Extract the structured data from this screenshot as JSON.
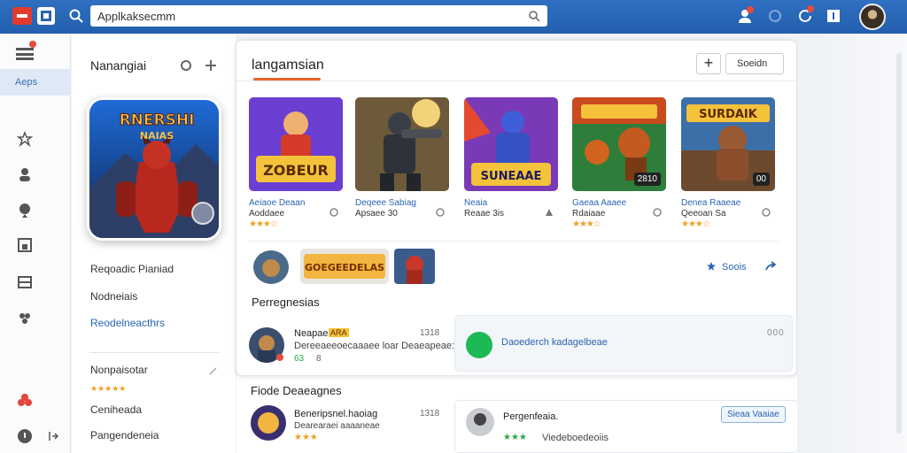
{
  "header": {
    "search_value": "Applkaksecmm",
    "notif_count": "",
    "profile": "avatar"
  },
  "icons": {
    "brand": "brand-logo-icon",
    "grid": "grid-logo-icon",
    "search": "search-icon",
    "user": "user-icon",
    "settings": "settings-icon",
    "refresh": "refresh-icon",
    "info": "info-icon"
  },
  "rail": {
    "active_label": "Aeps"
  },
  "left": {
    "title": "Nanangiai",
    "links": [
      "Reqoadic Pianiad",
      "Nodneiais",
      "Reodelneacthrs"
    ],
    "section_title": "Nonpaisotar",
    "section_stars": "★★★★★",
    "sub_links": [
      "Ceniheada",
      "Pangendeneia"
    ]
  },
  "panel": {
    "title": "langamsian",
    "add_label": "+",
    "sort_label": "Soeidn",
    "apps": [
      {
        "name": "Aeiaoe Deaan",
        "dev": "Aoddaee",
        "stars": "★★★☆",
        "art": "ZOBEUR",
        "tag": ""
      },
      {
        "name": "Deqeee Sabiag",
        "dev": "Apsaee 30",
        "stars": "",
        "art": "",
        "tag": ""
      },
      {
        "name": "Neaia",
        "dev": "Reaae 3is",
        "stars": "",
        "art": "SUNEAAE",
        "tag": ""
      },
      {
        "name": "Gaeaa Aaaee",
        "dev": "Rdaiaae",
        "stars": "★★★☆",
        "art": "",
        "tag": "2810"
      },
      {
        "name": "Denea Raaeae",
        "dev": "Qeeoan Sa",
        "stars": "★★★☆",
        "art": "SURDAIK",
        "tag": "00"
      }
    ],
    "banner_text": "GOEGEEDELAS",
    "share_label": "Soois",
    "section1": "Perregnesias",
    "msg1": {
      "name": "Neapae",
      "tag": "ARA",
      "desc": "Dereeaeeoecaaaee loar Deaeapeae:",
      "meta_left": "63",
      "meta_mid": "8",
      "time": "1318",
      "dots": "000"
    },
    "chat1": "Daoederch kadagelbeae",
    "section2": "Fiode Deaeagnes",
    "msg2": {
      "name": "Beneripsnel.haoiag",
      "desc": "Dearearaei aaaaneae",
      "time": "1318",
      "stars": "★★★"
    },
    "card2": {
      "title": "Pergenfeaia.",
      "sub": "Viedeboedeoiis",
      "stars": "★★★",
      "button": "Sieaa Vaaiae"
    }
  }
}
